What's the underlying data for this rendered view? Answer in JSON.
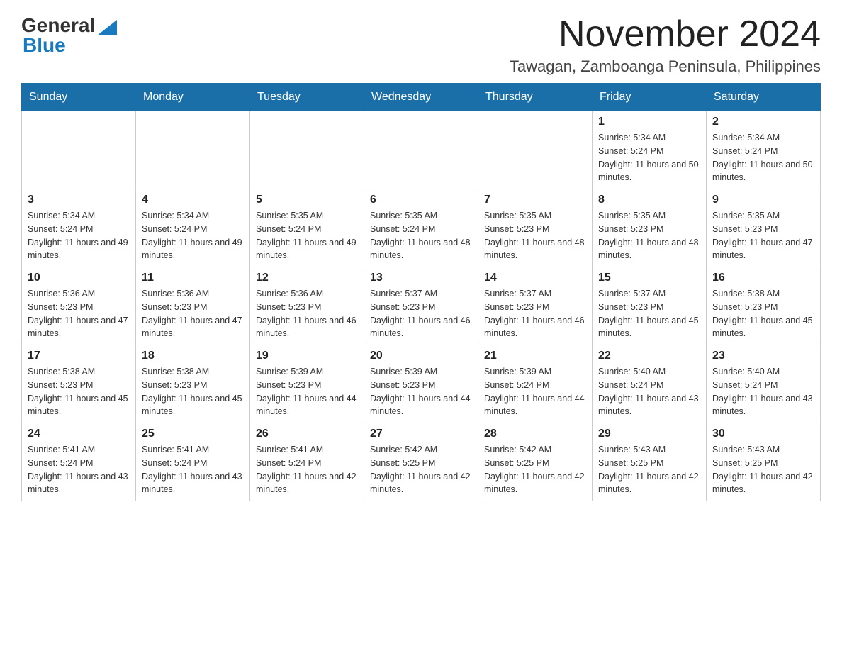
{
  "header": {
    "logo_general": "General",
    "logo_blue": "Blue",
    "main_title": "November 2024",
    "subtitle": "Tawagan, Zamboanga Peninsula, Philippines"
  },
  "days_of_week": [
    "Sunday",
    "Monday",
    "Tuesday",
    "Wednesday",
    "Thursday",
    "Friday",
    "Saturday"
  ],
  "weeks": [
    [
      {
        "day": "",
        "info": ""
      },
      {
        "day": "",
        "info": ""
      },
      {
        "day": "",
        "info": ""
      },
      {
        "day": "",
        "info": ""
      },
      {
        "day": "",
        "info": ""
      },
      {
        "day": "1",
        "info": "Sunrise: 5:34 AM\nSunset: 5:24 PM\nDaylight: 11 hours and 50 minutes."
      },
      {
        "day": "2",
        "info": "Sunrise: 5:34 AM\nSunset: 5:24 PM\nDaylight: 11 hours and 50 minutes."
      }
    ],
    [
      {
        "day": "3",
        "info": "Sunrise: 5:34 AM\nSunset: 5:24 PM\nDaylight: 11 hours and 49 minutes."
      },
      {
        "day": "4",
        "info": "Sunrise: 5:34 AM\nSunset: 5:24 PM\nDaylight: 11 hours and 49 minutes."
      },
      {
        "day": "5",
        "info": "Sunrise: 5:35 AM\nSunset: 5:24 PM\nDaylight: 11 hours and 49 minutes."
      },
      {
        "day": "6",
        "info": "Sunrise: 5:35 AM\nSunset: 5:24 PM\nDaylight: 11 hours and 48 minutes."
      },
      {
        "day": "7",
        "info": "Sunrise: 5:35 AM\nSunset: 5:23 PM\nDaylight: 11 hours and 48 minutes."
      },
      {
        "day": "8",
        "info": "Sunrise: 5:35 AM\nSunset: 5:23 PM\nDaylight: 11 hours and 48 minutes."
      },
      {
        "day": "9",
        "info": "Sunrise: 5:35 AM\nSunset: 5:23 PM\nDaylight: 11 hours and 47 minutes."
      }
    ],
    [
      {
        "day": "10",
        "info": "Sunrise: 5:36 AM\nSunset: 5:23 PM\nDaylight: 11 hours and 47 minutes."
      },
      {
        "day": "11",
        "info": "Sunrise: 5:36 AM\nSunset: 5:23 PM\nDaylight: 11 hours and 47 minutes."
      },
      {
        "day": "12",
        "info": "Sunrise: 5:36 AM\nSunset: 5:23 PM\nDaylight: 11 hours and 46 minutes."
      },
      {
        "day": "13",
        "info": "Sunrise: 5:37 AM\nSunset: 5:23 PM\nDaylight: 11 hours and 46 minutes."
      },
      {
        "day": "14",
        "info": "Sunrise: 5:37 AM\nSunset: 5:23 PM\nDaylight: 11 hours and 46 minutes."
      },
      {
        "day": "15",
        "info": "Sunrise: 5:37 AM\nSunset: 5:23 PM\nDaylight: 11 hours and 45 minutes."
      },
      {
        "day": "16",
        "info": "Sunrise: 5:38 AM\nSunset: 5:23 PM\nDaylight: 11 hours and 45 minutes."
      }
    ],
    [
      {
        "day": "17",
        "info": "Sunrise: 5:38 AM\nSunset: 5:23 PM\nDaylight: 11 hours and 45 minutes."
      },
      {
        "day": "18",
        "info": "Sunrise: 5:38 AM\nSunset: 5:23 PM\nDaylight: 11 hours and 45 minutes."
      },
      {
        "day": "19",
        "info": "Sunrise: 5:39 AM\nSunset: 5:23 PM\nDaylight: 11 hours and 44 minutes."
      },
      {
        "day": "20",
        "info": "Sunrise: 5:39 AM\nSunset: 5:23 PM\nDaylight: 11 hours and 44 minutes."
      },
      {
        "day": "21",
        "info": "Sunrise: 5:39 AM\nSunset: 5:24 PM\nDaylight: 11 hours and 44 minutes."
      },
      {
        "day": "22",
        "info": "Sunrise: 5:40 AM\nSunset: 5:24 PM\nDaylight: 11 hours and 43 minutes."
      },
      {
        "day": "23",
        "info": "Sunrise: 5:40 AM\nSunset: 5:24 PM\nDaylight: 11 hours and 43 minutes."
      }
    ],
    [
      {
        "day": "24",
        "info": "Sunrise: 5:41 AM\nSunset: 5:24 PM\nDaylight: 11 hours and 43 minutes."
      },
      {
        "day": "25",
        "info": "Sunrise: 5:41 AM\nSunset: 5:24 PM\nDaylight: 11 hours and 43 minutes."
      },
      {
        "day": "26",
        "info": "Sunrise: 5:41 AM\nSunset: 5:24 PM\nDaylight: 11 hours and 42 minutes."
      },
      {
        "day": "27",
        "info": "Sunrise: 5:42 AM\nSunset: 5:25 PM\nDaylight: 11 hours and 42 minutes."
      },
      {
        "day": "28",
        "info": "Sunrise: 5:42 AM\nSunset: 5:25 PM\nDaylight: 11 hours and 42 minutes."
      },
      {
        "day": "29",
        "info": "Sunrise: 5:43 AM\nSunset: 5:25 PM\nDaylight: 11 hours and 42 minutes."
      },
      {
        "day": "30",
        "info": "Sunrise: 5:43 AM\nSunset: 5:25 PM\nDaylight: 11 hours and 42 minutes."
      }
    ]
  ]
}
